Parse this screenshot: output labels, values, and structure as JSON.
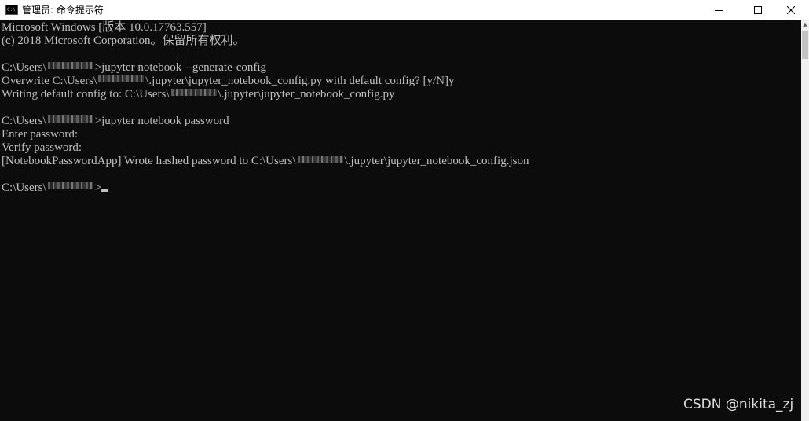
{
  "window": {
    "title": "管理员: 命令提示符",
    "icon_label": "C:\\",
    "min_icon": "minimize-icon",
    "max_icon": "maximize-icon",
    "close_icon": "close-icon"
  },
  "terminal": {
    "lines": {
      "l1": "Microsoft Windows [版本 10.0.17763.557]",
      "l2": "(c) 2018 Microsoft Corporation。保留所有权利。",
      "l3a": "C:\\Users\\",
      "l3b": ">jupyter notebook --generate-config",
      "l4a": "Overwrite C:\\Users\\",
      "l4b": "\\.jupyter\\jupyter_notebook_config.py with default config? [y/N]y",
      "l5a": "Writing default config to: C:\\Users\\",
      "l5b": "\\.jupyter\\jupyter_notebook_config.py",
      "l6a": "C:\\Users\\",
      "l6b": ">jupyter notebook password",
      "l7": "Enter password:",
      "l8": "Verify password:",
      "l9a": "[NotebookPasswordApp] Wrote hashed password to C:\\Users\\",
      "l9b": "\\.jupyter\\jupyter_notebook_config.json",
      "l10a": "C:\\Users\\",
      "l10b": ">"
    }
  },
  "watermark": "CSDN @nikita_zj",
  "colors": {
    "background": "#0c0c0c",
    "text": "#c0c0c0",
    "titlebar": "#ffffff"
  }
}
